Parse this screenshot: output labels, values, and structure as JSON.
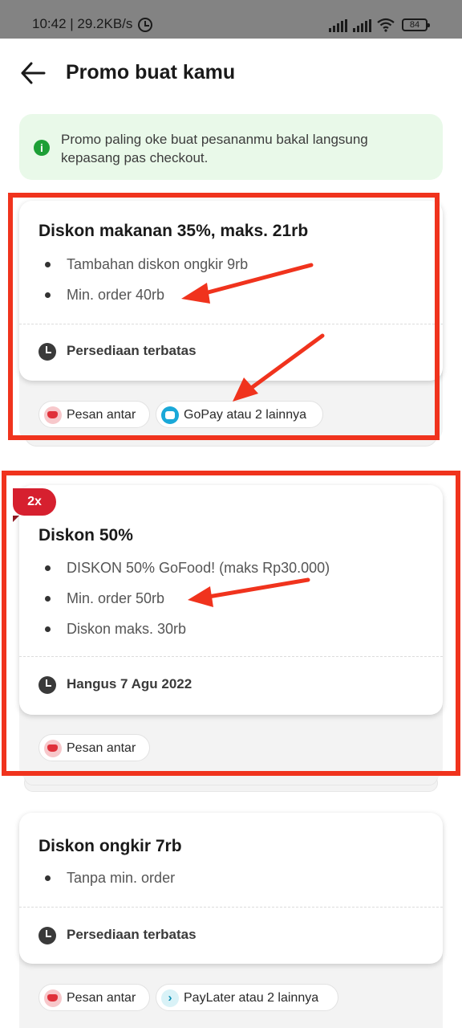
{
  "status_bar": {
    "time": "10:42 | 29.2KB/s",
    "battery": "84"
  },
  "header": {
    "title": "Promo buat kamu"
  },
  "info_banner": {
    "icon": "info-icon",
    "text": "Promo paling oke buat pesananmu bakal langsung kepasang pas checkout."
  },
  "promos": [
    {
      "title": "Diskon makanan 35%, maks. 21rb",
      "bullets": [
        "Tambahan diskon ongkir 9rb",
        "Min. order 40rb"
      ],
      "footer": "Persediaan terbatas",
      "chips": [
        "Pesan antar",
        "GoPay atau 2 lainnya"
      ]
    },
    {
      "badge": "2x",
      "title": "Diskon 50%",
      "bullets": [
        "DISKON 50% GoFood! (maks Rp30.000)",
        "Min. order 50rb",
        "Diskon maks. 30rb"
      ],
      "footer": "Hangus 7 Agu 2022",
      "chips": [
        "Pesan antar"
      ]
    },
    {
      "title": "Diskon ongkir 7rb",
      "bullets": [
        "Tanpa min. order"
      ],
      "footer": "Persediaan terbatas",
      "chips": [
        "Pesan antar",
        "PayLater atau 2 lainnya"
      ]
    }
  ],
  "colors": {
    "annotation": "#f0331d",
    "badge": "#d6202f",
    "banner_bg": "#e9f9e9",
    "info_icon": "#1d9f36"
  }
}
